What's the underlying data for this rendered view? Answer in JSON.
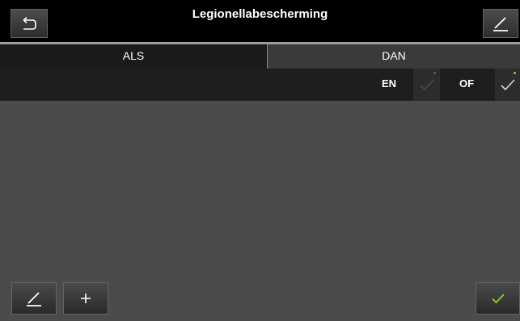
{
  "header": {
    "title": "Legionellabescherming"
  },
  "tabs": [
    {
      "label": "ALS",
      "selected": true
    },
    {
      "label": "DAN",
      "selected": false
    }
  ],
  "options": [
    {
      "label": "EN",
      "checked": false
    },
    {
      "label": "OF",
      "checked": true
    }
  ],
  "colors": {
    "accent_green": "#8ed12a",
    "led_inactive": "#5a5a5a",
    "check_inactive": "#4a4a4a",
    "check_active": "#d8d8d8"
  },
  "icons": {
    "back": "back-arrow-icon",
    "edit": "pencil-icon",
    "add": "plus-icon",
    "confirm": "checkmark-icon"
  }
}
